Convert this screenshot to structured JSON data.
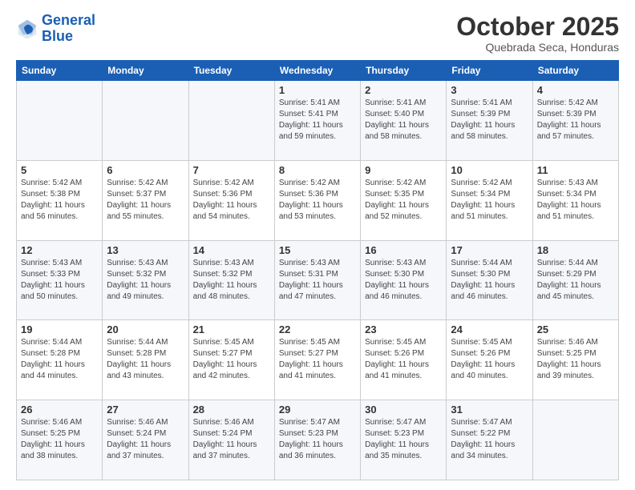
{
  "header": {
    "logo_line1": "General",
    "logo_line2": "Blue",
    "month": "October 2025",
    "location": "Quebrada Seca, Honduras"
  },
  "weekdays": [
    "Sunday",
    "Monday",
    "Tuesday",
    "Wednesday",
    "Thursday",
    "Friday",
    "Saturday"
  ],
  "weeks": [
    [
      {
        "day": "",
        "info": ""
      },
      {
        "day": "",
        "info": ""
      },
      {
        "day": "",
        "info": ""
      },
      {
        "day": "1",
        "info": "Sunrise: 5:41 AM\nSunset: 5:41 PM\nDaylight: 11 hours\nand 59 minutes."
      },
      {
        "day": "2",
        "info": "Sunrise: 5:41 AM\nSunset: 5:40 PM\nDaylight: 11 hours\nand 58 minutes."
      },
      {
        "day": "3",
        "info": "Sunrise: 5:41 AM\nSunset: 5:39 PM\nDaylight: 11 hours\nand 58 minutes."
      },
      {
        "day": "4",
        "info": "Sunrise: 5:42 AM\nSunset: 5:39 PM\nDaylight: 11 hours\nand 57 minutes."
      }
    ],
    [
      {
        "day": "5",
        "info": "Sunrise: 5:42 AM\nSunset: 5:38 PM\nDaylight: 11 hours\nand 56 minutes."
      },
      {
        "day": "6",
        "info": "Sunrise: 5:42 AM\nSunset: 5:37 PM\nDaylight: 11 hours\nand 55 minutes."
      },
      {
        "day": "7",
        "info": "Sunrise: 5:42 AM\nSunset: 5:36 PM\nDaylight: 11 hours\nand 54 minutes."
      },
      {
        "day": "8",
        "info": "Sunrise: 5:42 AM\nSunset: 5:36 PM\nDaylight: 11 hours\nand 53 minutes."
      },
      {
        "day": "9",
        "info": "Sunrise: 5:42 AM\nSunset: 5:35 PM\nDaylight: 11 hours\nand 52 minutes."
      },
      {
        "day": "10",
        "info": "Sunrise: 5:42 AM\nSunset: 5:34 PM\nDaylight: 11 hours\nand 51 minutes."
      },
      {
        "day": "11",
        "info": "Sunrise: 5:43 AM\nSunset: 5:34 PM\nDaylight: 11 hours\nand 51 minutes."
      }
    ],
    [
      {
        "day": "12",
        "info": "Sunrise: 5:43 AM\nSunset: 5:33 PM\nDaylight: 11 hours\nand 50 minutes."
      },
      {
        "day": "13",
        "info": "Sunrise: 5:43 AM\nSunset: 5:32 PM\nDaylight: 11 hours\nand 49 minutes."
      },
      {
        "day": "14",
        "info": "Sunrise: 5:43 AM\nSunset: 5:32 PM\nDaylight: 11 hours\nand 48 minutes."
      },
      {
        "day": "15",
        "info": "Sunrise: 5:43 AM\nSunset: 5:31 PM\nDaylight: 11 hours\nand 47 minutes."
      },
      {
        "day": "16",
        "info": "Sunrise: 5:43 AM\nSunset: 5:30 PM\nDaylight: 11 hours\nand 46 minutes."
      },
      {
        "day": "17",
        "info": "Sunrise: 5:44 AM\nSunset: 5:30 PM\nDaylight: 11 hours\nand 46 minutes."
      },
      {
        "day": "18",
        "info": "Sunrise: 5:44 AM\nSunset: 5:29 PM\nDaylight: 11 hours\nand 45 minutes."
      }
    ],
    [
      {
        "day": "19",
        "info": "Sunrise: 5:44 AM\nSunset: 5:28 PM\nDaylight: 11 hours\nand 44 minutes."
      },
      {
        "day": "20",
        "info": "Sunrise: 5:44 AM\nSunset: 5:28 PM\nDaylight: 11 hours\nand 43 minutes."
      },
      {
        "day": "21",
        "info": "Sunrise: 5:45 AM\nSunset: 5:27 PM\nDaylight: 11 hours\nand 42 minutes."
      },
      {
        "day": "22",
        "info": "Sunrise: 5:45 AM\nSunset: 5:27 PM\nDaylight: 11 hours\nand 41 minutes."
      },
      {
        "day": "23",
        "info": "Sunrise: 5:45 AM\nSunset: 5:26 PM\nDaylight: 11 hours\nand 41 minutes."
      },
      {
        "day": "24",
        "info": "Sunrise: 5:45 AM\nSunset: 5:26 PM\nDaylight: 11 hours\nand 40 minutes."
      },
      {
        "day": "25",
        "info": "Sunrise: 5:46 AM\nSunset: 5:25 PM\nDaylight: 11 hours\nand 39 minutes."
      }
    ],
    [
      {
        "day": "26",
        "info": "Sunrise: 5:46 AM\nSunset: 5:25 PM\nDaylight: 11 hours\nand 38 minutes."
      },
      {
        "day": "27",
        "info": "Sunrise: 5:46 AM\nSunset: 5:24 PM\nDaylight: 11 hours\nand 37 minutes."
      },
      {
        "day": "28",
        "info": "Sunrise: 5:46 AM\nSunset: 5:24 PM\nDaylight: 11 hours\nand 37 minutes."
      },
      {
        "day": "29",
        "info": "Sunrise: 5:47 AM\nSunset: 5:23 PM\nDaylight: 11 hours\nand 36 minutes."
      },
      {
        "day": "30",
        "info": "Sunrise: 5:47 AM\nSunset: 5:23 PM\nDaylight: 11 hours\nand 35 minutes."
      },
      {
        "day": "31",
        "info": "Sunrise: 5:47 AM\nSunset: 5:22 PM\nDaylight: 11 hours\nand 34 minutes."
      },
      {
        "day": "",
        "info": ""
      }
    ]
  ]
}
